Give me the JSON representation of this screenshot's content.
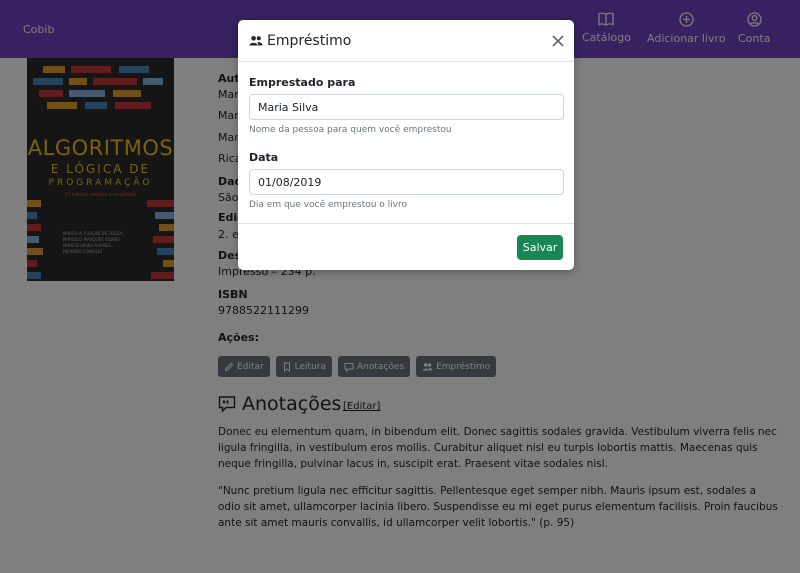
{
  "navbar": {
    "brand": "Cobib",
    "items": [
      {
        "label": "Catálogo",
        "icon": "book-icon"
      },
      {
        "label": "Adicionar livro",
        "icon": "plus-circle-icon"
      },
      {
        "label": "Conta",
        "icon": "person-circle-icon"
      }
    ],
    "color": "#6f42c1"
  },
  "cover": {
    "title_line1": "ALGORITMOS",
    "title_line2": "E LÓGICA DE",
    "title_line3": "PROGRAMAÇÃO",
    "subtitle": "2ª edição revista e ampliada",
    "authors": [
      "MARCO A. FURLAN DE SOUZA",
      "MARCELO MARQUES GOMES",
      "MARCIO VIEIRA SOARES",
      "RICARDO CONCILIO"
    ]
  },
  "book": {
    "authors_label": "Auto",
    "author_lines": [
      "Marc",
      "Marc",
      "Marc",
      "Rica"
    ],
    "publisher_label": "Dad",
    "publisher_value": "São",
    "edition_label": "Ediç",
    "edition_value": "2. ed",
    "description_label": "Desc",
    "description_value": "Impresso – 234 p.",
    "isbn_label": "ISBN",
    "isbn_value": "9788522111299"
  },
  "actions": {
    "label": "Ações:",
    "buttons": [
      {
        "label": "Editar",
        "icon": "pencil-icon"
      },
      {
        "label": "Leitura",
        "icon": "bookmark-icon"
      },
      {
        "label": "Anotações",
        "icon": "chat-quote-icon"
      },
      {
        "label": "Empréstimo",
        "icon": "people-icon"
      }
    ]
  },
  "notes": {
    "heading": "Anotações",
    "edit_link": "[Editar]",
    "paragraphs": [
      "Donec eu elementum quam, in bibendum elit. Donec sagittis sodales gravida. Vestibulum viverra felis nec ligula fringilla, in vestibulum eros mollis. Curabitur aliquet nisl eu turpis lobortis mattis. Maecenas quis neque fringilla, pulvinar lacus in, suscipit erat. Praesent vitae sodales nisl.",
      "\"Nunc pretium ligula nec efficitur sagittis. Pellentesque eget semper nibh. Mauris ipsum est, sodales a odio sit amet, ullamcorper lacinia libero. Suspendisse eu mi eget purus elementum facilisis. Proin faucibus ante sit amet mauris convallis, id ullamcorper velit lobortis.\" (p. 95)"
    ]
  },
  "modal": {
    "title": "Empréstimo",
    "title_icon": "people-icon",
    "lent_to_label": "Emprestado para",
    "lent_to_value": "Maria Silva",
    "lent_to_help": "Nome da pessoa para quem você emprestou",
    "date_label": "Data",
    "date_value": "01/08/2019",
    "date_help": "Dia em que você emprestou o livro",
    "save_label": "Salvar",
    "save_color": "#198754"
  }
}
